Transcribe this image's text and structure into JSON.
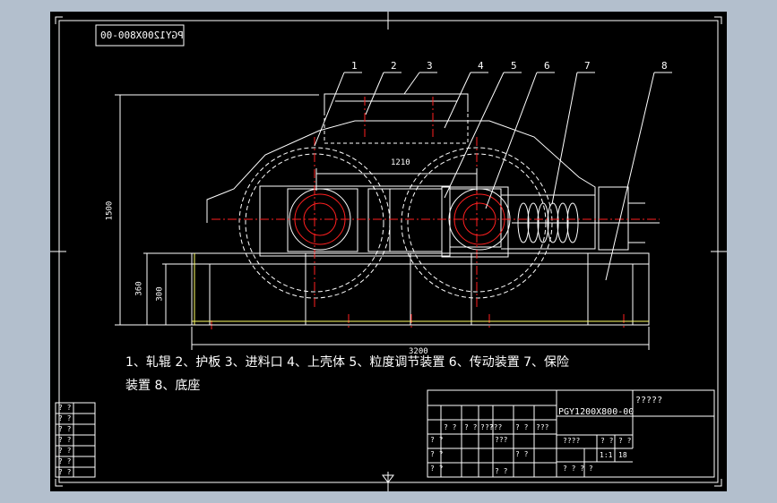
{
  "drawing_code_mirrored": "PGY1200X800-00",
  "balloons": [
    "1",
    "2",
    "3",
    "4",
    "5",
    "6",
    "7",
    "8"
  ],
  "dimensions": {
    "center_distance": "1210",
    "total_length": "3200",
    "total_height": "1500",
    "base_height": "360",
    "base_inner_height": "300"
  },
  "legend": {
    "line1": "1、轧辊    2、护板    3、进料口    4、上壳体    5、粒度调节装置    6、传动装置    7、保险",
    "line2": "装置    8、底座"
  },
  "title_block": {
    "drawing_number": "PGY1200X800-00",
    "drawing_name": "?????",
    "left_cells": [
      "? ?",
      "? ?",
      "? ?",
      "? ?",
      "? ?",
      "? ?",
      "? ?"
    ],
    "row_marks": [
      "? ?",
      "? ?",
      "? ?",
      "????",
      "? ?",
      "???"
    ],
    "mark_col_row2": "? ?",
    "mark_col_row3": "???",
    "mark_a": "? ?",
    "mark_b": "? ?",
    "mark_c": "? ?",
    "mark_d": "? ?",
    "stage_label": "????",
    "weight_label": "? ?",
    "scale_label": "? ?",
    "scale_value": "1:1",
    "weight_value": "18",
    "sheet_marks": "?   ?        ?  ?"
  },
  "colors": {
    "background": "#b3bfcd",
    "sheet": "#000000",
    "line_white": "#ffffff",
    "center_red": "#ff2020",
    "base_yellow": "#ffff66"
  }
}
